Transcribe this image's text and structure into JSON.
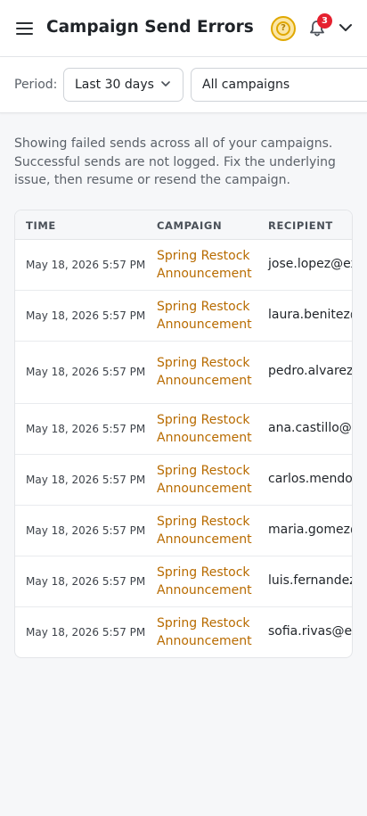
{
  "header": {
    "title": "Campaign Send Errors",
    "help_icon": "question-circle-icon",
    "help_glyph": "?",
    "notifications_icon": "bell-icon",
    "notifications_count": "3",
    "account_menu_icon": "chevron-down-icon"
  },
  "filters": {
    "period_label": "Period:",
    "period_value": "Last 30 days",
    "campaign_value": "All campaigns"
  },
  "intro_text": "Showing failed sends across all of your campaigns. Successful sends are not logged. Fix the underlying issue, then resume or resend the campaign.",
  "table": {
    "columns": [
      "TIME",
      "CAMPAIGN",
      "RECIPIENT"
    ],
    "rows": [
      {
        "time": "May 18, 2026 5:57 PM",
        "campaign": "Spring Restock Announcement",
        "recipient": "jose.lopez@ex"
      },
      {
        "time": "May 18, 2026 5:57 PM",
        "campaign": "Spring Restock Announcement",
        "recipient": "laura.benitez@"
      },
      {
        "time": "May 18, 2026 5:57 PM",
        "campaign": "Spring Restock Announcement",
        "recipient": "pedro.alvarez@"
      },
      {
        "time": "May 18, 2026 5:57 PM",
        "campaign": "Spring Restock Announcement",
        "recipient": "ana.castillo@ex"
      },
      {
        "time": "May 18, 2026 5:57 PM",
        "campaign": "Spring Restock Announcement",
        "recipient": "carlos.mendoz"
      },
      {
        "time": "May 18, 2026 5:57 PM",
        "campaign": "Spring Restock Announcement",
        "recipient": "maria.gomez@"
      },
      {
        "time": "May 18, 2026 5:57 PM",
        "campaign": "Spring Restock Announcement",
        "recipient": "luis.fernandez"
      },
      {
        "time": "May 18, 2026 5:57 PM",
        "campaign": "Spring Restock Announcement",
        "recipient": "sofia.rivas@ex"
      }
    ]
  },
  "colors": {
    "accent": "#b86b00",
    "help_ring": "#e0a800",
    "badge": "#e5212f"
  }
}
